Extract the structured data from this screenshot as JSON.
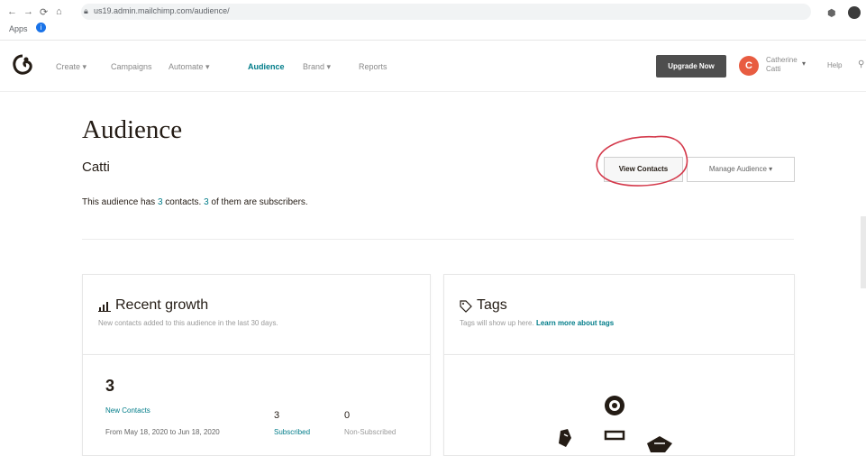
{
  "browser": {
    "back": "←",
    "forward": "→",
    "reload": "⟳",
    "home": "⌂",
    "url": "us19.admin.mailchimp.com/audience/",
    "bookmark_apps": "Apps"
  },
  "header": {
    "nav": [
      {
        "label": "Create ▾"
      },
      {
        "label": "Campaigns"
      },
      {
        "label": "Automate ▾"
      },
      {
        "label": "Audience"
      },
      {
        "label": "Brand ▾"
      },
      {
        "label": "Reports"
      }
    ],
    "upgrade_label": "Upgrade Now",
    "avatar_initial": "C",
    "user_name": "Catherine Catti",
    "help_label": "Help"
  },
  "page": {
    "title": "Audience",
    "audience_name": "Catti",
    "summary": {
      "prefix": "This audience has ",
      "contacts": "3",
      "middle": " contacts. ",
      "subscribers": "3",
      "suffix": " of them are subscribers."
    },
    "view_contacts_label": "View Contacts",
    "manage_audience_label": "Manage Audience ▾"
  },
  "growth": {
    "icon": "bar-chart-icon",
    "title": "Recent growth",
    "subtitle": "New contacts added to this audience in the last 30 days.",
    "new_contacts_count": "3",
    "new_contacts_label": "New Contacts",
    "date_range": "From May 18, 2020 to Jun 18, 2020",
    "subscribed_count": "3",
    "subscribed_label": "Subscribed",
    "non_subscribed_count": "0",
    "non_subscribed_label": "Non-Subscribed"
  },
  "tags": {
    "icon": "tag-icon",
    "title": "Tags",
    "subtitle": "Tags will show up here. ",
    "learn_more": "Learn more about tags"
  },
  "colors": {
    "accent": "#007c89",
    "upgrade": "#4e4e4e",
    "avatar": "#e85c41",
    "annotation": "#d4394b"
  }
}
